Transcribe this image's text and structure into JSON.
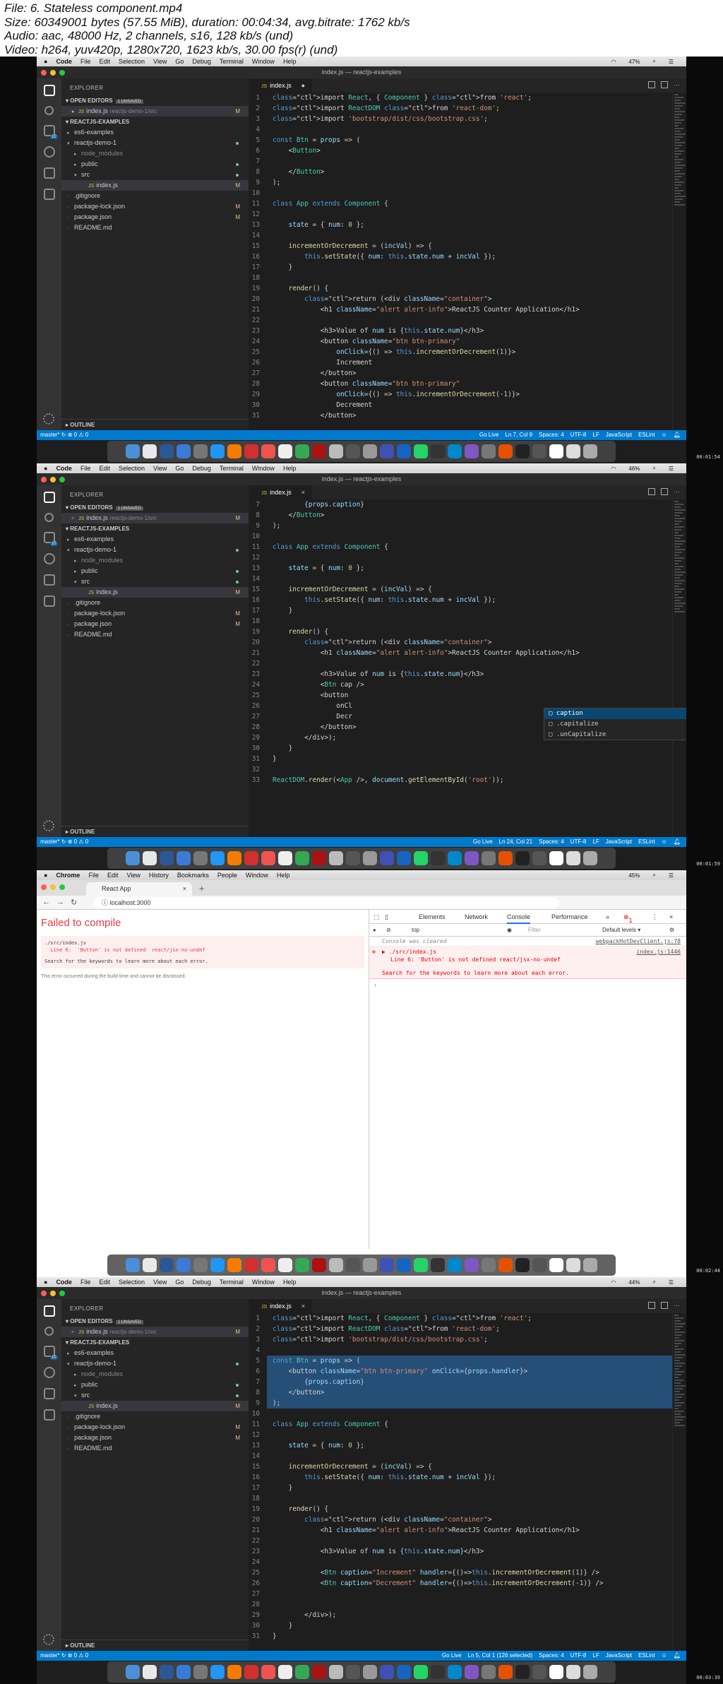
{
  "header": {
    "line1": "File: 6. Stateless component.mp4",
    "line2": "Size: 60349001 bytes (57.55 MiB), duration: 00:04:34, avg.bitrate: 1762 kb/s",
    "line3": "Audio: aac, 48000 Hz, 2 channels, s16, 128 kb/s (und)",
    "line4": "Video: h264, yuv420p, 1280x720, 1623 kb/s, 30.00 fps(r) (und)"
  },
  "vscode": {
    "menus": [
      "Code",
      "File",
      "Edit",
      "Selection",
      "View",
      "Go",
      "Debug",
      "Terminal",
      "Window",
      "Help"
    ],
    "window_title": "index.js — reactjs-examples",
    "explorer_title": "EXPLORER",
    "open_editors": "OPEN EDITORS",
    "unsaved": "1 UNSAVED",
    "open_file": "index.js",
    "open_file_path": "reactjs-demo-1/src",
    "project": "REACTJS-EXAMPLES",
    "tree": [
      "es6-examples",
      "reactjs-demo-1",
      "node_modules",
      "public",
      "src",
      "index.js",
      ".gitignore",
      "package-lock.json",
      "package.json",
      "README.md"
    ],
    "status_m": "M",
    "outline": "OUTLINE",
    "tab": "index.js",
    "branch": "master*",
    "errors": "⊗ 0 ⚠ 0",
    "go_live": "Go Live",
    "spaces": "Spaces: 4",
    "encoding": "UTF-8",
    "eol": "LF",
    "language": "JavaScript",
    "eslint": "ESLint"
  },
  "frames": [
    {
      "timestamp": "00:01:54",
      "battery": "47%",
      "time": "",
      "cursor": "Ln 7, Col 9",
      "tab_close": "●"
    },
    {
      "timestamp": "00:01:59",
      "battery": "46%",
      "cursor": "Ln 24, Col 21",
      "tab_close": "×"
    },
    {
      "timestamp": "00:02:44",
      "battery": "45%"
    },
    {
      "timestamp": "00:03:39",
      "battery": "44%",
      "cursor": "Ln 5, Col 1 (126 selected)",
      "tab_close": "×"
    }
  ],
  "code1": [
    "import React, { Component } from 'react';",
    "import ReactDOM from 'react-dom';",
    "import 'bootstrap/dist/css/bootstrap.css';",
    "",
    "const Btn = props => (",
    "    <Button>",
    "",
    "    </Button>",
    ");",
    "",
    "class App extends Component {",
    "",
    "    state = { num: 0 };",
    "",
    "    incrementOrDecrement = (incVal) => {",
    "        this.setState({ num: this.state.num + incVal });",
    "    }",
    "",
    "    render() {",
    "        return (<div className=\"container\">",
    "            <h1 className=\"alert alert-info\">ReactJS Counter Application</h1>",
    "",
    "            <h3>Value of num is {this.state.num}</h3>",
    "            <button className=\"btn btn-primary\"",
    "                onClick={() => this.incrementOrDecrement(1)}>",
    "                Increment",
    "            </button>",
    "            <button className=\"btn btn-primary\"",
    "                onClick={() => this.incrementOrDecrement(-1)}>",
    "                Decrement",
    "            </button>"
  ],
  "code2": [
    "        {props.caption}",
    "    </Button>",
    ");",
    "",
    "class App extends Component {",
    "",
    "    state = { num: 0 };",
    "",
    "    incrementOrDecrement = (incVal) => {",
    "        this.setState({ num: this.state.num + incVal });",
    "    }",
    "",
    "    render() {",
    "        return (<div className=\"container\">",
    "            <h1 className=\"alert alert-info\">ReactJS Counter Application</h1>",
    "",
    "            <h3>Value of num is {this.state.num}</h3>",
    "            <Btn cap />",
    "            <button",
    "                onCl",
    "                Decr",
    "            </button>",
    "        </div>);",
    "    }",
    "}",
    "",
    "ReactDOM.render(<App />, document.getElementById('root'));"
  ],
  "code2_start": 7,
  "autocomplete": [
    "caption",
    ".capitalize",
    ".unCapitalize"
  ],
  "code4": [
    "import React, { Component } from 'react';",
    "import ReactDOM from 'react-dom';",
    "import 'bootstrap/dist/css/bootstrap.css';",
    "",
    "const Btn = props => (",
    "    <button className=\"btn btn-primary\" onClick={props.handler}>",
    "        {props.caption}",
    "    </button>",
    ");",
    "",
    "class App extends Component {",
    "",
    "    state = { num: 0 };",
    "",
    "    incrementOrDecrement = (incVal) => {",
    "        this.setState({ num: this.state.num + incVal });",
    "    }",
    "",
    "    render() {",
    "        return (<div className=\"container\">",
    "            <h1 className=\"alert alert-info\">ReactJS Counter Application</h1>",
    "",
    "            <h3>Value of num is {this.state.num}</h3>",
    "",
    "            <Btn caption=\"Increment\" handler={()=>this.incrementOrDecrement(1)} />",
    "            <Btn caption=\"Decrement\" handler={()=>this.incrementOrDecrement(-1)} />",
    "",
    "",
    "        </div>);",
    "    }",
    "}"
  ],
  "chrome": {
    "menus": [
      "Chrome",
      "File",
      "Edit",
      "View",
      "History",
      "Bookmarks",
      "People",
      "Window",
      "Help"
    ],
    "tab_title": "React App",
    "url": "localhost:3000",
    "failed": "Failed to compile",
    "err_file": "./src/index.js",
    "err_line": "  Line 6:  'Button' is not defined  react/jsx-no-undef",
    "err_search": "Search for the keywords to learn more about each error.",
    "err_note": "This error occurred during the build time and cannot be dismissed.",
    "dt_tabs": [
      "Elements",
      "Network",
      "Console",
      "Performance"
    ],
    "dt_top": "top",
    "dt_filter": "Filter",
    "dt_levels": "Default levels ▾",
    "con_cleared": "Console was cleared",
    "con_cleared_src": "webpackHotDevClient.js:78",
    "con_err_file": "▶ ./src/index.js",
    "con_err_src": "index.js:1446",
    "con_err_line": "Line 6:  'Button' is not defined  react/jsx-no-undef",
    "con_err_search": "Search for the keywords to learn more about each error.",
    "err_count": "1"
  }
}
